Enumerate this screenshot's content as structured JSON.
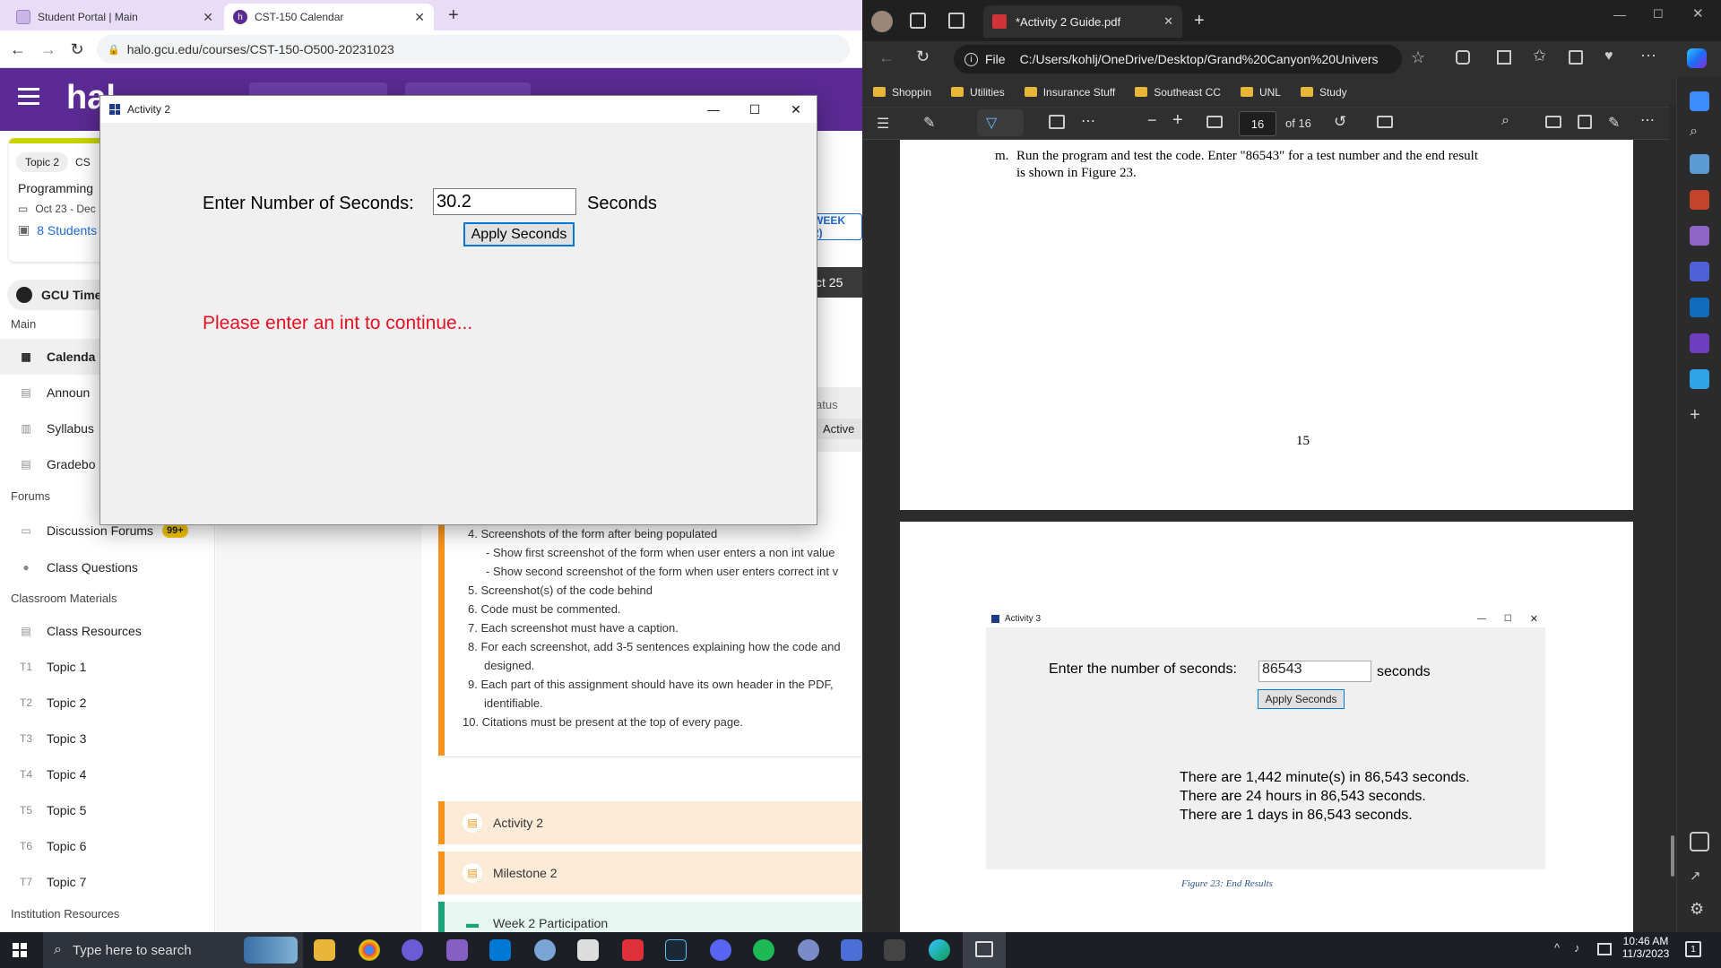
{
  "chrome": {
    "tabs": [
      {
        "label": "Student Portal | Main"
      },
      {
        "label": "CST-150 Calendar"
      }
    ],
    "new_tab": "+",
    "url": "halo.gcu.edu/courses/CST-150-O500-20231023",
    "halo_logo": "hal",
    "topic_card": {
      "chip": "Topic 2",
      "chip_suffix": "CS",
      "course": "Programming",
      "dates": "Oct 23 - Dec",
      "students": "8 Students"
    },
    "gcu_time": "GCU Time",
    "sections": {
      "main": "Main",
      "forums": "Forums",
      "classroom": "Classroom Materials",
      "institution": "Institution Resources"
    },
    "nav": {
      "calendar": "Calenda",
      "announcements": "Announ",
      "syllabus": "Syllabus",
      "gradebook": "Gradebo",
      "discussion": "Discussion Forums",
      "discussion_badge": "99+",
      "class_questions": "Class Questions",
      "class_resources": "Class Resources"
    },
    "topics": [
      {
        "code": "T1",
        "label": "Topic 1"
      },
      {
        "code": "T2",
        "label": "Topic 2"
      },
      {
        "code": "T3",
        "label": "Topic 3"
      },
      {
        "code": "T4",
        "label": "Topic 4"
      },
      {
        "code": "T5",
        "label": "Topic 5"
      },
      {
        "code": "T6",
        "label": "Topic 6"
      },
      {
        "code": "T7",
        "label": "Topic 7"
      }
    ],
    "week_btn": "WEEK 2)",
    "date_bar": "ct 25",
    "status_label": "atus",
    "status_value": "Active",
    "requirements": [
      "4. Screenshots of the form after being populated",
      "- Show first screenshot of the form when user enters a non int value",
      "- Show second screenshot of the form when user enters correct int v",
      "5. Screenshot(s) of the code behind",
      "6. Code must be commented.",
      "7. Each screenshot must have a caption.",
      "8. For each screenshot, add 3-5 sentences explaining how the code and",
      "designed.",
      "9. Each part of this assignment should have its own header in the PDF,",
      "identifiable.",
      "10. Citations must be present at the top of every page."
    ],
    "activities": [
      {
        "label": "Activity 2",
        "color": "#f7941d"
      },
      {
        "label": "Milestone 2",
        "color": "#f7941d"
      },
      {
        "label": "Week 2 Participation",
        "color": "#1aa37a"
      }
    ]
  },
  "dialog": {
    "title": "Activity 2",
    "prompt": "Enter Number of Seconds:",
    "input_value": "30.2",
    "unit": "Seconds",
    "button": "Apply Seconds",
    "error": "Please enter an int to continue...",
    "error_color": "#e81123"
  },
  "edge": {
    "tab_title": "*Activity 2 Guide.pdf",
    "url_scheme": "File",
    "url": "C:/Users/kohlj/OneDrive/Desktop/Grand%20Canyon%20Univers...",
    "favorites": [
      "Shoppin",
      "Utilities",
      "Insurance Stuff",
      "Southeast CC",
      "UNL",
      "Study"
    ],
    "page_current": "16",
    "page_total": "of 16",
    "pdf": {
      "step_letter": "m.",
      "step_text_1": "Run the program and test the code. Enter \"86543\" for a test number and the end result",
      "step_text_2": "is shown in Figure 23.",
      "page_number": "15",
      "figure": {
        "title": "Activity 3",
        "prompt": "Enter the number of seconds:",
        "input_value": "86543",
        "unit": "seconds",
        "button": "Apply Seconds",
        "results": [
          "There are 1,442 minute(s) in 86,543 seconds.",
          "There are 24 hours in 86,543 seconds.",
          "There are 1 days in 86,543 seconds."
        ]
      },
      "caption": "Figure 23: End Results"
    }
  },
  "taskbar": {
    "search_placeholder": "Type here to search",
    "time": "10:46 AM",
    "date": "11/3/2023",
    "notification_count": "1"
  }
}
